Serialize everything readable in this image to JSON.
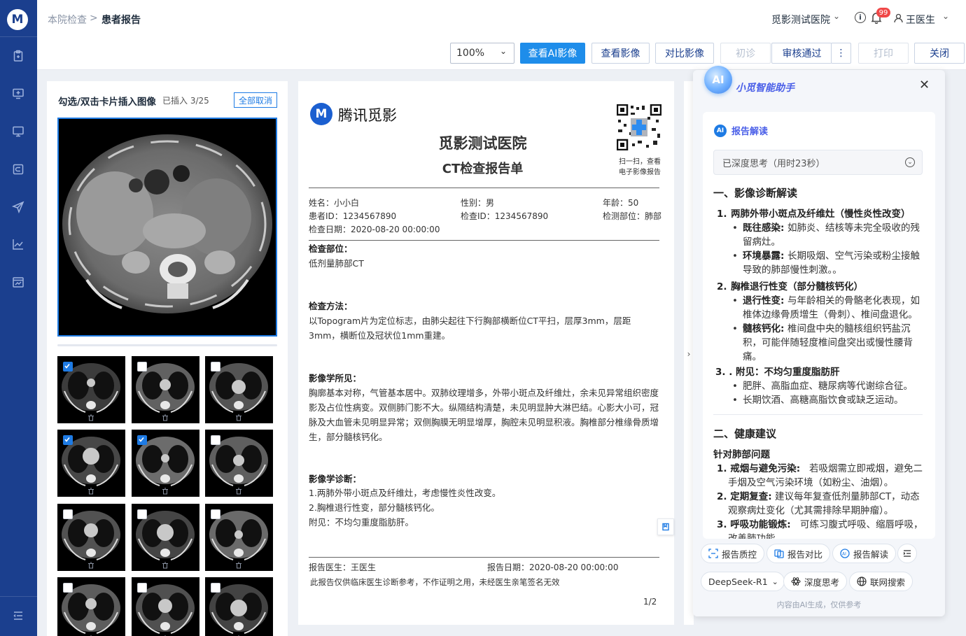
{
  "app": {
    "logo": "M"
  },
  "breadcrumb": {
    "parent": "本院检查",
    "separator": ">",
    "current": "患者报告"
  },
  "header": {
    "hospital": "觅影测试医院",
    "notifications": "99",
    "user": "王医生"
  },
  "toolbar": {
    "zoom": "100%",
    "view_ai": "查看AI影像",
    "view_image": "查看影像",
    "compare_image": "对比影像",
    "first_diag": "初诊",
    "approve": "审核通过",
    "more": "⋮",
    "print": "打印",
    "close": "关闭"
  },
  "colors": {
    "accent": "#1e8dea",
    "sidebar": "#1b3f8e",
    "checkbox": "#1e7be4"
  },
  "left": {
    "title": "勾选/双击卡片插入图像",
    "count": "已插入 3/25",
    "cancel_all": "全部取消",
    "thumbs": [
      {
        "checked": true
      },
      {
        "checked": false
      },
      {
        "checked": false
      },
      {
        "checked": true
      },
      {
        "checked": true
      },
      {
        "checked": false
      },
      {
        "checked": false
      },
      {
        "checked": false
      },
      {
        "checked": false
      },
      {
        "checked": false
      },
      {
        "checked": false
      },
      {
        "checked": false
      }
    ]
  },
  "report": {
    "brand": "腾讯觅影",
    "hospital": "觅影测试医院",
    "title": "CT检查报告单",
    "qr_caption1": "扫一扫，查看",
    "qr_caption2": "电子影像报告",
    "name": "姓名：小小白",
    "gender": "性别：男",
    "age": "年龄：50",
    "patient_id": "患者ID：1234567890",
    "exam_id": "检查ID：1234567890",
    "body_part": "检测部位：肺部",
    "exam_date": "检查日期：2020-08-20  00:00:00",
    "sec_part_h": "检查部位：",
    "sec_part": "低剂量肺部CT",
    "sec_method_h": "检查方法：",
    "sec_method": "以Topogram片为定位标志，由肺尖起往下行胸部横断位CT平扫，层厚3mm，层距3mm，横断位及冠状位1mm重建。",
    "sec_find_h": "影像学所见：",
    "sec_find": "胸廓基本对称，气管基本居中。双肺纹理增多，外带小斑点及纤维灶，余未见异常组织密度影及占位性病变。双侧肺门影不大。纵隔结构清楚，未见明显肿大淋巴结。心影大小可，冠脉及大血管未见明显异常；双侧胸膜无明显增厚，胸腔未见明显积液。胸椎部分椎缘骨质增生，部分髓核钙化。",
    "sec_diag_h": "影像学诊断：",
    "diag1": "1.两肺外带小斑点及纤维灶，考虑慢性炎性改变。",
    "diag2": "2.胸椎退行性变，部分髓核钙化。",
    "diag3": "附见：不均匀重度脂肪肝。",
    "doctor": "报告医生：王医生",
    "report_date": "报告日期：2020-08-20  00:00:00",
    "disclaimer": "此报告仅供临床医生诊断参考，不作证明之用，未经医生亲笔签名无效",
    "page": "1/2"
  },
  "ai": {
    "title": "小觅智能助手",
    "badge": "AI",
    "section": "报告解读",
    "thinking": "已深度思考（用时23秒）",
    "h1": "一、影像诊断解读",
    "i1": "1.",
    "i1t": "两肺外带小斑点及纤维灶（慢性炎性改变）",
    "b1k": "既往感染:",
    "b1v1": "如肺炎、结核等未完全吸收的残",
    "b1v2": "留病灶。",
    "b2k": "环境暴露:",
    "b2v1": "长期吸烟、空气污染或粉尘接触",
    "b2v2": "导致的肺部慢性刺激。。",
    "i2": "2.",
    "i2t": "胸椎退行性变（部分髓核钙化）",
    "b3k": "退行性变:",
    "b3v1": "与年龄相关的骨骼老化表现，如",
    "b3v2": "椎体边缘骨质增生（骨刺）、椎间盘退化。",
    "b4k": "髓核钙化:",
    "b4v1": "椎间盘中央的髓核组织钙盐沉",
    "b4v2": "积，可能伴随轻度椎间盘突出或慢性腰背",
    "b4v3": "痛。",
    "i3": "3. . 附见：不均匀重度脂肪肝",
    "b5": "肥胖、高脂血症、糖尿病等代谢综合征。",
    "b6": "长期饮酒、高糖高脂饮食或缺乏运动。",
    "h2": "二、健康建议",
    "sub": "针对肺部问题",
    "s1k": "1. 戒烟与避免污染:",
    "s1v1": "若吸烟需立即戒烟，避免二",
    "s1v2": "手烟及空气污染环境（如粉尘、油烟）。",
    "s2k": "2. 定期复查:",
    "s2v1": "建议每年复查低剂量肺部CT，动态",
    "s2v2": "观察病灶变化（尤其需排除早期肿瘤）。",
    "s3k": "3. 呼吸功能锻炼:",
    "s3v1": "可练习腹式呼吸、缩唇呼吸，",
    "s3v2": "改善肺功能。",
    "chip_qc": "报告质控",
    "chip_cmp": "报告对比",
    "chip_read": "报告解读",
    "model": "DeepSeek-R1",
    "deep": "深度思考",
    "web": "联网搜索",
    "footer": "内容由AI生成，仅供参考"
  }
}
